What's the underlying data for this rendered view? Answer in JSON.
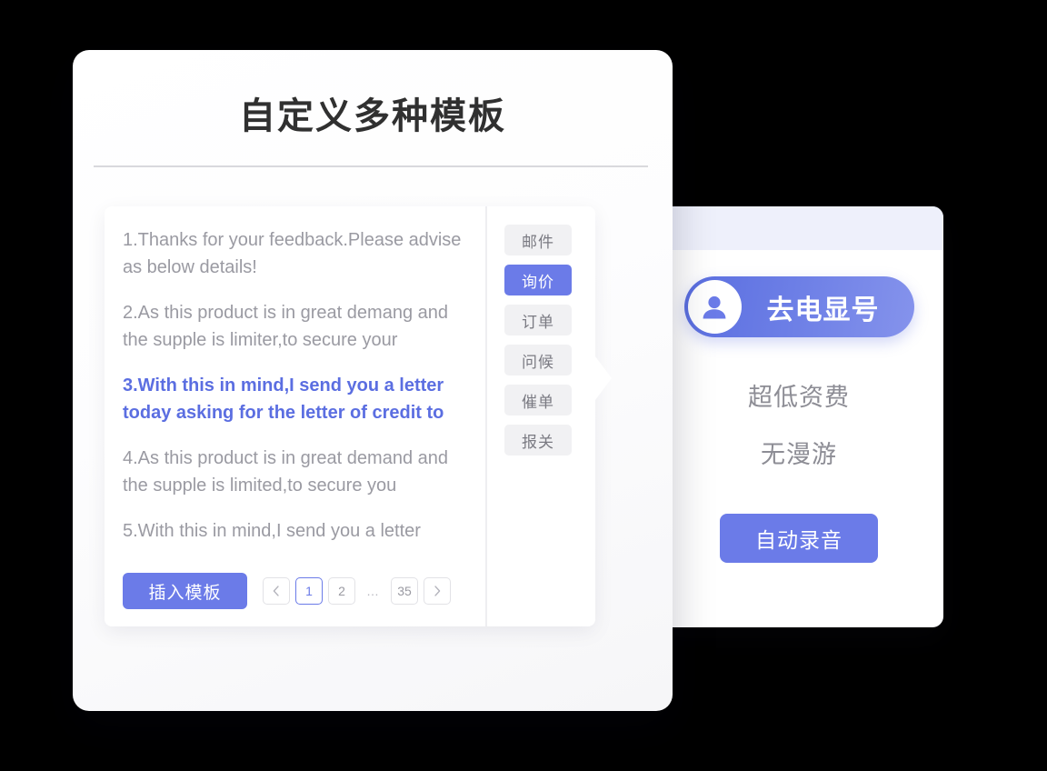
{
  "page": {
    "title": "自定义多种模板"
  },
  "template_panel": {
    "items": [
      {
        "text": "1.Thanks for your feedback.Please advise as below details!",
        "active": false
      },
      {
        "text": "2.As this product is in great demang and the supple is limiter,to secure your",
        "active": false
      },
      {
        "text": "3.With this in mind,I send you a letter today asking for the letter of credit to",
        "active": true
      },
      {
        "text": "4.As this product is in great demand and the supple is limited,to secure you",
        "active": false
      },
      {
        "text": "5.With this in mind,I send you a letter",
        "active": false
      }
    ],
    "tags": [
      {
        "label": "邮件",
        "active": false
      },
      {
        "label": "询价",
        "active": true
      },
      {
        "label": "订单",
        "active": false
      },
      {
        "label": "问候",
        "active": false
      },
      {
        "label": "催单",
        "active": false
      },
      {
        "label": "报关",
        "active": false
      }
    ],
    "insert_button_label": "插入模板",
    "pagination": {
      "prev_icon": "chevron-left-icon",
      "next_icon": "chevron-right-icon",
      "pages": [
        "1",
        "2",
        "…",
        "35"
      ],
      "current_page": "1"
    }
  },
  "right_panel": {
    "caller_id": {
      "avatar_icon": "user-avatar-icon",
      "label": "去电显号"
    },
    "features": [
      "超低资费",
      "无漫游"
    ],
    "record_button_label": "自动录音"
  },
  "colors": {
    "accent_blue": "#6B7BE8",
    "active_text_blue": "#5B6EE1",
    "muted_text": "#9A9AA2",
    "chip_bg": "#F1F1F3",
    "panel_header_lavender": "#EEF0FB",
    "background": "#000000"
  }
}
